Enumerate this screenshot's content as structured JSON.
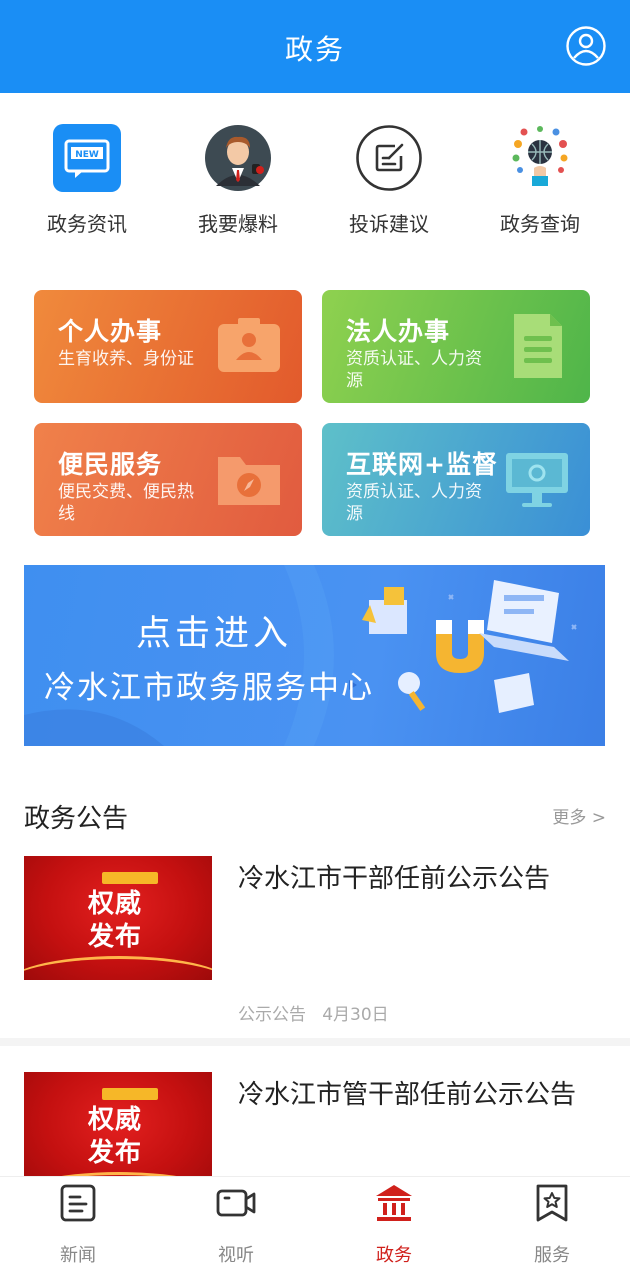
{
  "header": {
    "title": "政务"
  },
  "quick": [
    {
      "label": "政务资讯",
      "icon": "news-icon",
      "badge": "NEW"
    },
    {
      "label": "我要爆料",
      "icon": "reporter-avatar-icon"
    },
    {
      "label": "投诉建议",
      "icon": "edit-note-icon"
    },
    {
      "label": "政务查询",
      "icon": "globe-network-icon"
    }
  ],
  "cards": [
    {
      "title": "个人办事",
      "sub": "生育收养、身份证",
      "icon": "id-card-icon",
      "color_from": "#f08a3c",
      "color_to": "#e25a2c"
    },
    {
      "title": "法人办事",
      "sub": "资质认证、人力资源",
      "icon": "document-icon",
      "color_from": "#8fd14f",
      "color_to": "#4fb54a"
    },
    {
      "title": "便民服务",
      "sub": "便民交费、便民热线",
      "icon": "folder-compass-icon",
      "color_from": "#f0814a",
      "color_to": "#e15b3f"
    },
    {
      "title": "互联网+监督",
      "sub": "资质认证、人力资源",
      "icon": "monitor-icon",
      "color_from": "#5ec0c9",
      "color_to": "#3a8fd6"
    }
  ],
  "banner": {
    "line1": "点击进入",
    "line2": "冷水江市政务服务中心"
  },
  "notices": {
    "title": "政务公告",
    "more": "更多 >",
    "items": [
      {
        "thumb_text1": "权威",
        "thumb_text2": "发布",
        "title": "冷水江市干部任前公示公告",
        "category": "公示公告",
        "date": "4月30日"
      },
      {
        "thumb_text1": "权威",
        "thumb_text2": "发布",
        "title": "冷水江市管干部任前公示公告",
        "category": "",
        "date": ""
      }
    ]
  },
  "tabs": [
    {
      "label": "新闻",
      "icon": "news-tab-icon",
      "active": false
    },
    {
      "label": "视听",
      "icon": "video-camera-icon",
      "active": false
    },
    {
      "label": "政务",
      "icon": "government-building-icon",
      "active": true
    },
    {
      "label": "服务",
      "icon": "star-bookmark-icon",
      "active": false
    }
  ],
  "colors": {
    "primary": "#1a8ef5",
    "active_tab": "#d0211c",
    "thumb_red": "#c41010"
  }
}
